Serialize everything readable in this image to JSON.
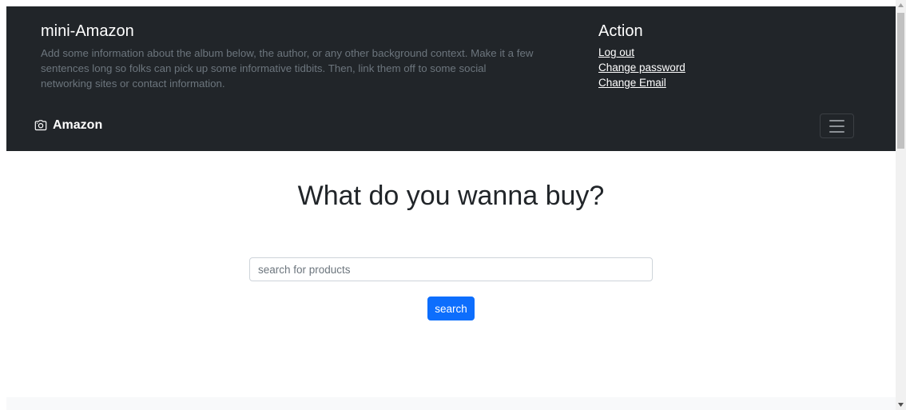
{
  "header": {
    "about_title": "mini-Amazon",
    "about_text": "Add some information about the album below, the author, or any other background context. Make it a few sentences long so folks can pick up some informative tidbits. Then, link them off to some social networking sites or contact information.",
    "action_title": "Action",
    "action_links": [
      {
        "label": "Log out"
      },
      {
        "label": "Change password"
      },
      {
        "label": "Change Email"
      }
    ]
  },
  "navbar": {
    "brand_label": "Amazon",
    "brand_icon": "camera-icon",
    "toggler_icon": "hamburger-menu-icon"
  },
  "main": {
    "headline": "What do you wanna buy?",
    "search_placeholder": "search for products",
    "search_value": "",
    "search_button_label": "search"
  },
  "colors": {
    "header_bg": "#212529",
    "muted_text": "#6c757d",
    "primary_button": "#0d6efd",
    "footer_bg": "#f8f9fa"
  },
  "icons": {
    "scroll_up": "scroll-up-arrow-icon",
    "scroll_down": "scroll-down-arrow-icon"
  }
}
